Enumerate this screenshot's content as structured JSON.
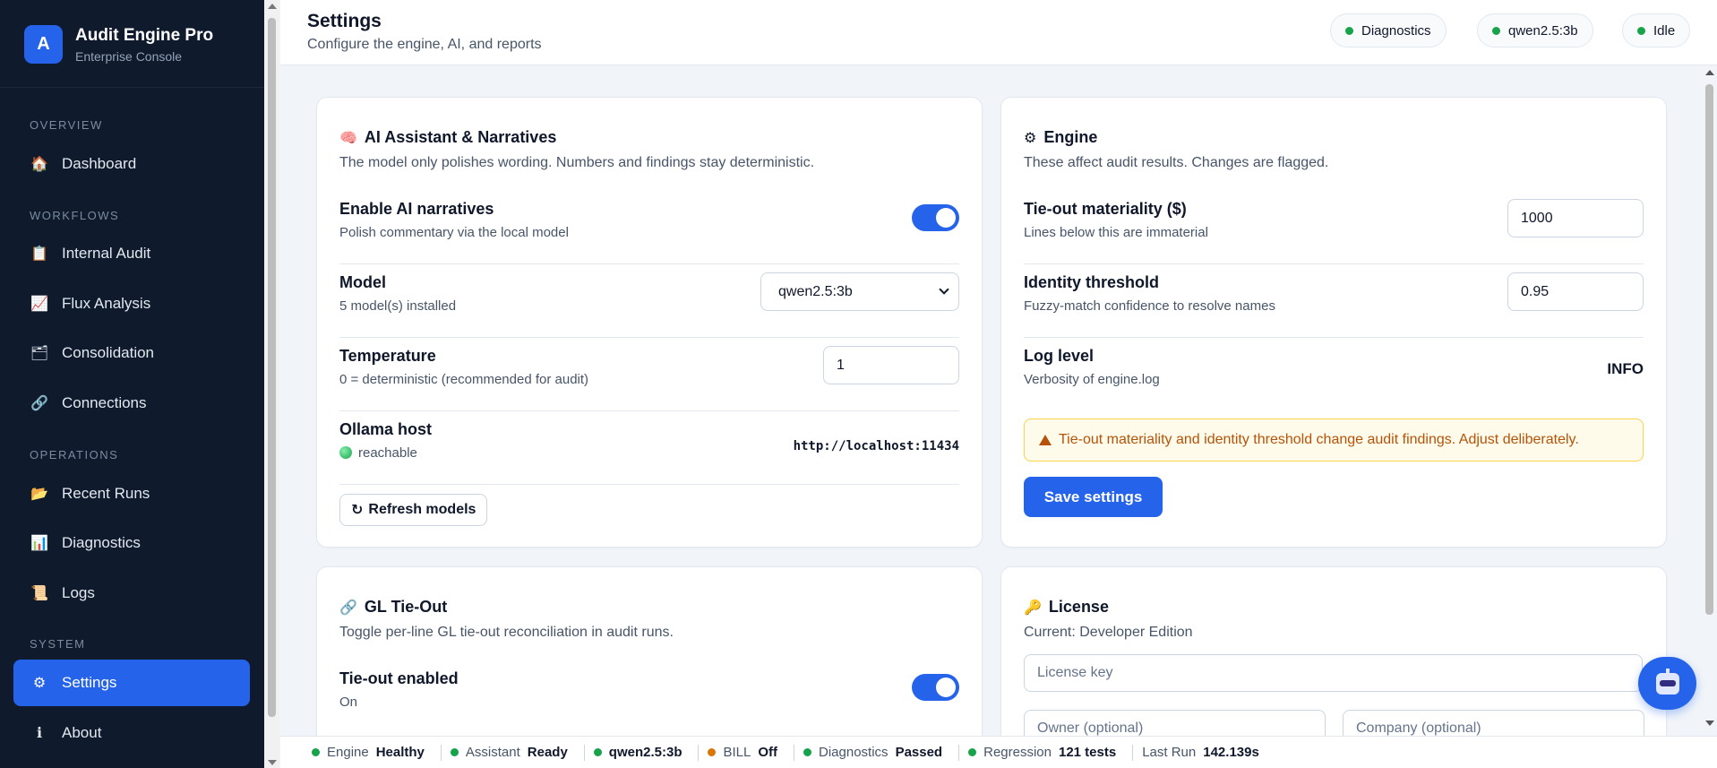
{
  "brand": {
    "logo_letter": "A",
    "title": "Audit Engine Pro",
    "subtitle": "Enterprise Console"
  },
  "sidebar": {
    "sections": [
      {
        "label": "OVERVIEW"
      },
      {
        "label": "WORKFLOWS"
      },
      {
        "label": "OPERATIONS"
      },
      {
        "label": "SYSTEM"
      }
    ],
    "items": [
      {
        "label": "Dashboard",
        "icon": "house-icon"
      },
      {
        "label": "Internal Audit",
        "icon": "clipboard-icon"
      },
      {
        "label": "Flux Analysis",
        "icon": "chart-up-icon"
      },
      {
        "label": "Consolidation",
        "icon": "folder-icon"
      },
      {
        "label": "Connections",
        "icon": "link-icon"
      },
      {
        "label": "Recent Runs",
        "icon": "open-folder-icon"
      },
      {
        "label": "Diagnostics",
        "icon": "bar-chart-icon"
      },
      {
        "label": "Logs",
        "icon": "scroll-icon"
      },
      {
        "label": "Settings",
        "icon": "gear-icon",
        "active": true
      },
      {
        "label": "About",
        "icon": "info-icon"
      }
    ]
  },
  "header": {
    "title": "Settings",
    "subtitle": "Configure the engine, AI, and reports",
    "pills": [
      {
        "label": "Diagnostics",
        "status_color": "#16a34a"
      },
      {
        "label": "qwen2.5:3b",
        "status_color": "#16a34a"
      },
      {
        "label": "Idle",
        "status_color": "#16a34a"
      }
    ]
  },
  "ai_card": {
    "icon": "brain-icon",
    "title": "AI Assistant & Narratives",
    "description": "The model only polishes wording. Numbers and findings stay deterministic.",
    "enable_label": "Enable AI narratives",
    "enable_hint": "Polish commentary via the local model",
    "enabled": true,
    "model_label": "Model",
    "model_hint": "5 model(s) installed",
    "model_value": "qwen2.5:3b",
    "temperature_label": "Temperature",
    "temperature_hint": "0 = deterministic (recommended for audit)",
    "temperature_value": "1",
    "host_label": "Ollama host",
    "host_status": "reachable",
    "host_value": "http://localhost:11434",
    "refresh_label": "Refresh models"
  },
  "engine_card": {
    "icon": "gear-icon",
    "title": "Engine",
    "description": "These affect audit results. Changes are flagged.",
    "materiality_label": "Tie-out materiality ($)",
    "materiality_hint": "Lines below this are immaterial",
    "materiality_value": "1000",
    "identity_label": "Identity threshold",
    "identity_hint": "Fuzzy-match confidence to resolve names",
    "identity_value": "0.95",
    "log_label": "Log level",
    "log_hint": "Verbosity of engine.log",
    "log_value": "INFO",
    "warning": "Tie-out materiality and identity threshold change audit findings. Adjust deliberately.",
    "save_label": "Save settings"
  },
  "gl_card": {
    "icon": "link-icon",
    "title": "GL Tie-Out",
    "description": "Toggle per-line GL tie-out reconciliation in audit runs.",
    "enabled_label": "Tie-out enabled",
    "enabled_hint": "On",
    "enabled": true
  },
  "license_card": {
    "icon": "key-icon",
    "title": "License",
    "current": "Current: Developer Edition",
    "key_placeholder": "License key",
    "owner_placeholder": "Owner (optional)",
    "company_placeholder": "Company (optional)"
  },
  "footer": {
    "items": [
      {
        "label": "Engine",
        "value": "Healthy",
        "status_color": "#16a34a"
      },
      {
        "label": "Assistant",
        "value": "Ready",
        "status_color": "#16a34a"
      },
      {
        "label": "",
        "value": "qwen2.5:3b",
        "status_color": "#16a34a"
      },
      {
        "label": "BILL",
        "value": "Off",
        "status_color": "#d97706"
      },
      {
        "label": "Diagnostics",
        "value": "Passed",
        "status_color": "#16a34a"
      },
      {
        "label": "Regression",
        "value": "121 tests",
        "status_color": "#16a34a"
      },
      {
        "label": "Last Run",
        "value": "142.139s"
      }
    ]
  },
  "colors": {
    "accent": "#2563eb",
    "sidebar_bg": "#0f1a2c",
    "success": "#16a34a",
    "warning": "#b45309"
  }
}
